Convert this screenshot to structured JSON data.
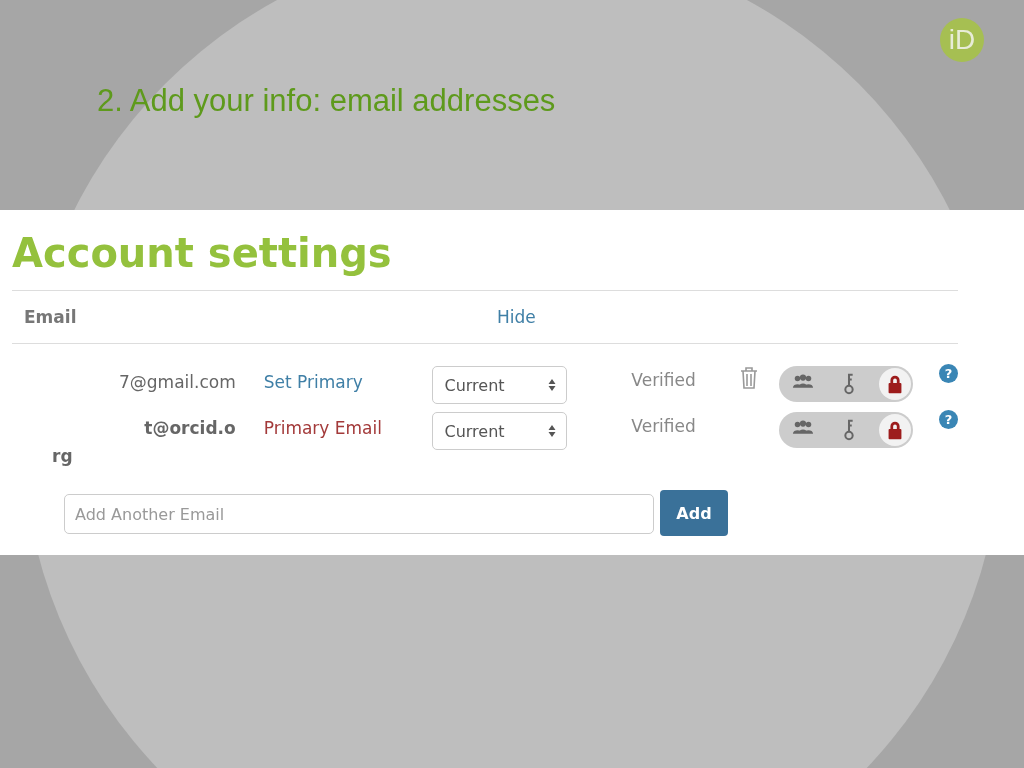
{
  "slide": {
    "title": "2. Add your info: email addresses",
    "logo": "iD"
  },
  "account": {
    "heading": "Account settings",
    "section": "Email",
    "toggle": "Hide",
    "emails": [
      {
        "lines": [
          "7@gmail.com"
        ],
        "primary": false,
        "primary_text": "Set Primary",
        "status": "Current",
        "verified": "Verified",
        "deletable": true,
        "privacy": [
          {
            "kind": "everyone",
            "selected": false
          },
          {
            "kind": "trusted",
            "selected": false
          },
          {
            "kind": "private",
            "selected": true
          }
        ],
        "help": "?"
      },
      {
        "lines": [
          "t@orcid.o",
          "rg"
        ],
        "primary": true,
        "primary_text": "Primary Email",
        "status": "Current",
        "verified": "Verified",
        "deletable": false,
        "privacy": [
          {
            "kind": "everyone",
            "selected": false
          },
          {
            "kind": "trusted",
            "selected": false
          },
          {
            "kind": "private",
            "selected": true
          }
        ],
        "help": "?"
      }
    ],
    "add": {
      "placeholder": "Add Another Email",
      "button": "Add"
    }
  }
}
